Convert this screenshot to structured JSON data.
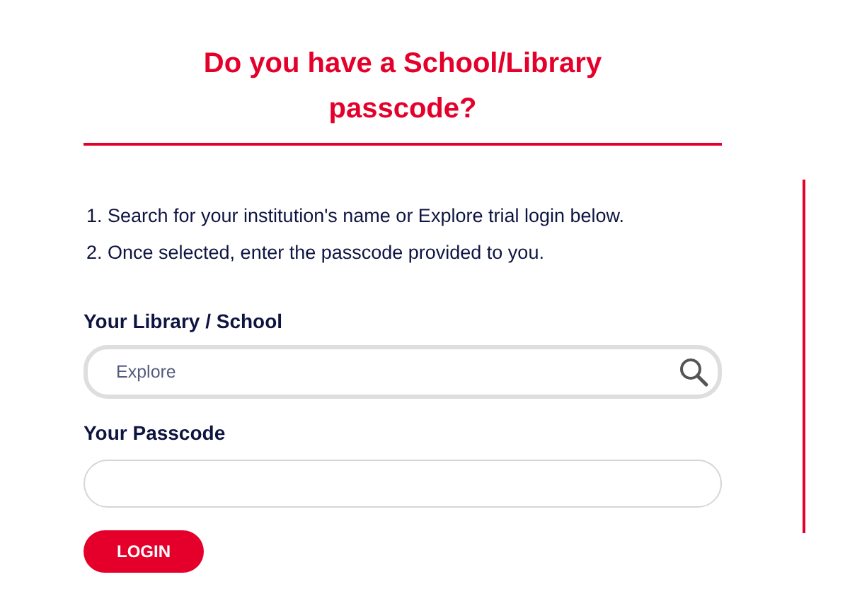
{
  "title": "Do you have a School/Library passcode?",
  "instructions": [
    "1. Search for your institution's name or Explore trial login below.",
    "2. Once selected, enter the passcode provided to you."
  ],
  "library_field": {
    "label": "Your Library / School",
    "value": "Explore",
    "focused": true
  },
  "passcode_field": {
    "label": "Your Passcode",
    "focused": false
  },
  "login_button": "LOGIN"
}
